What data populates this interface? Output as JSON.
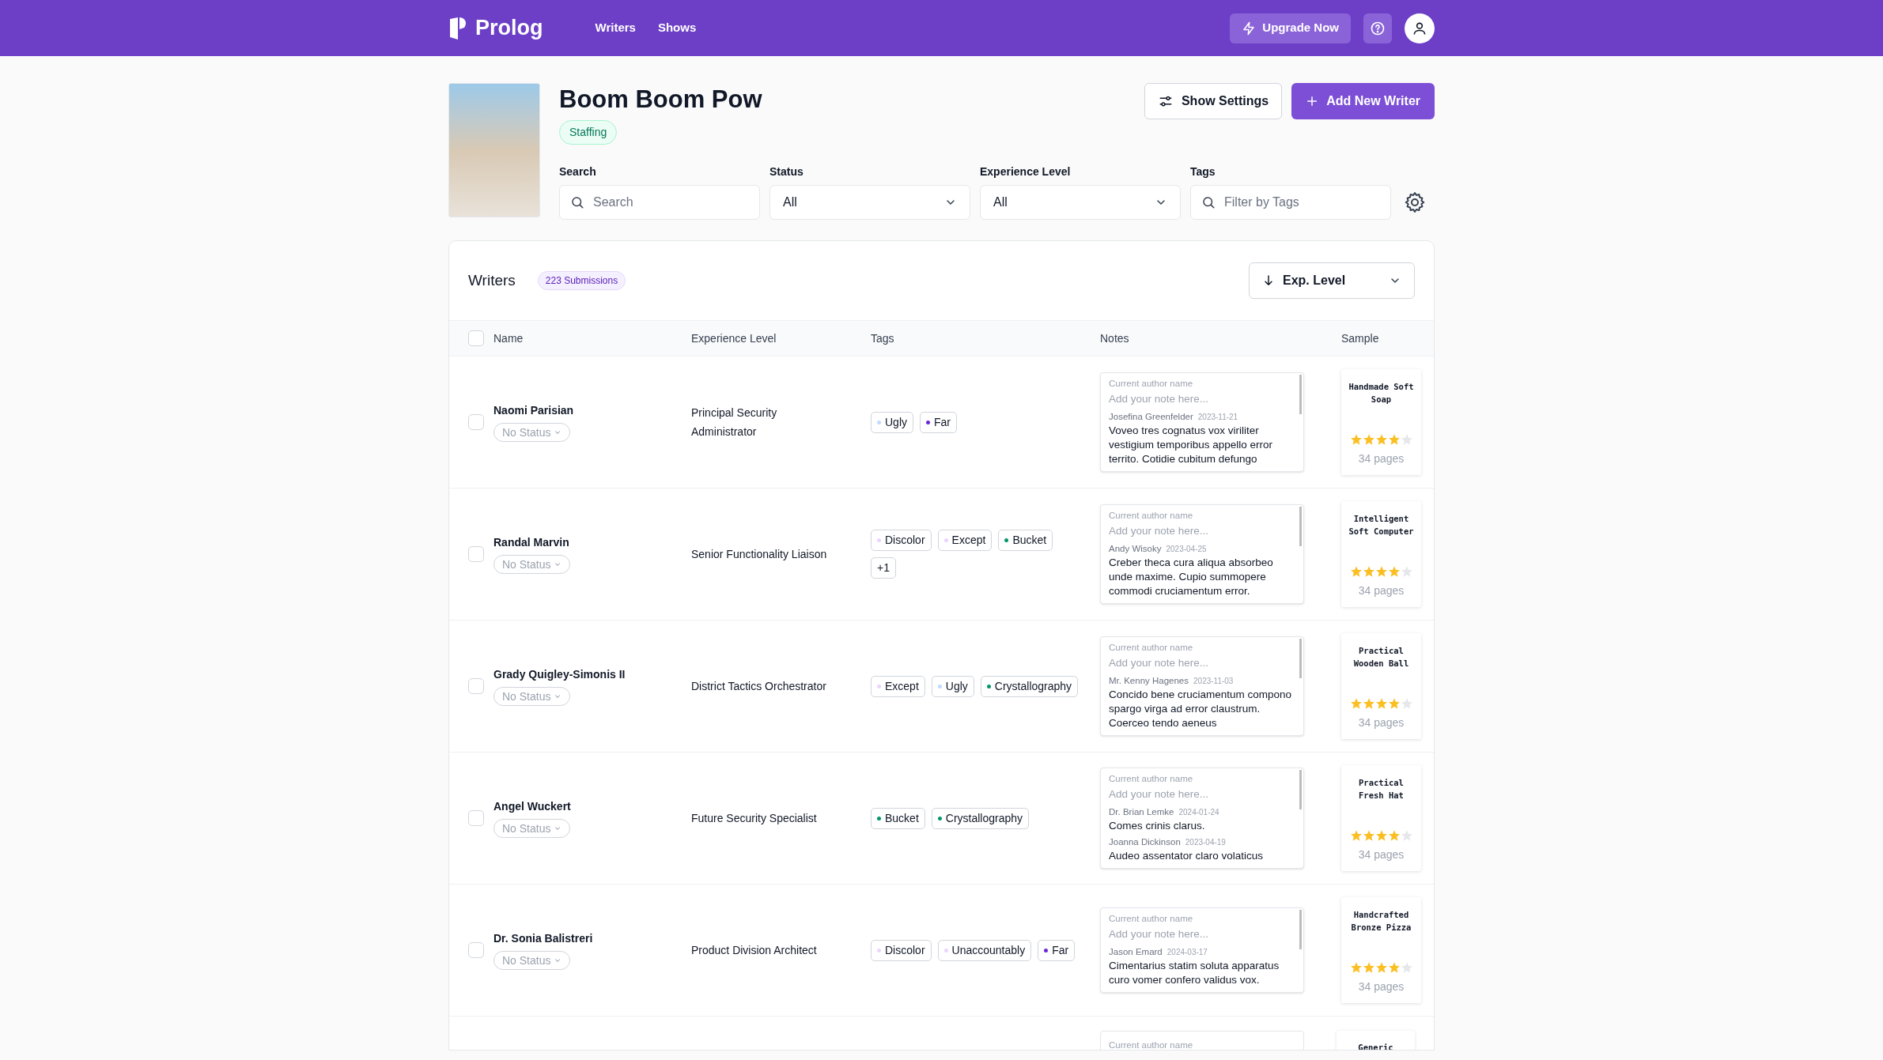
{
  "nav": {
    "logo": "Prolog",
    "links": [
      {
        "label": "Writers"
      },
      {
        "label": "Shows"
      }
    ],
    "upgrade": "Upgrade Now"
  },
  "show": {
    "title": "Boom Boom Pow",
    "badge": "Staffing",
    "actions": [
      {
        "kind": "secondary",
        "label": "Show Settings"
      },
      {
        "kind": "primary",
        "label": "Add New Writer"
      }
    ]
  },
  "filters": [
    {
      "kind": "search",
      "label": "Search",
      "placeholder": "Search"
    },
    {
      "kind": "select",
      "label": "Status",
      "value": "All"
    },
    {
      "kind": "select",
      "label": "Experience Level",
      "value": "All"
    },
    {
      "kind": "search",
      "label": "Tags",
      "placeholder": "Filter by Tags"
    }
  ],
  "writers": {
    "title": "Writers",
    "count": "223 Submissions",
    "sort": "Exp. Level",
    "select_all_checked": false,
    "columns": [
      "Name",
      "Experience Level",
      "Tags",
      "Notes",
      "Sample"
    ],
    "rows": [
      {
        "name": "Naomi Parisian",
        "checked": false,
        "status": "No Status",
        "experience": "Principal Security Administrator",
        "tags": [
          {
            "label": "Ugly",
            "color": "#bfdbfe"
          },
          {
            "label": "Far",
            "color": "#6d28d9"
          }
        ],
        "notes": {
          "label": "Current author name",
          "placeholder": "Add your note here...",
          "entries": [
            {
              "author": "Josefina Greenfelder",
              "date": "2023-11-21",
              "text": "Voveo tres cognatus vox viriliter vestigium temporibus appello error territo. Cotidie cubitum defungo"
            }
          ]
        },
        "sample": {
          "title": "Handmade Soft Soap",
          "stars": 4,
          "pages": "34 pages"
        }
      },
      {
        "name": "Randal Marvin",
        "checked": false,
        "status": "No Status",
        "experience": "Senior Functionality Liaison",
        "tags": [
          {
            "label": "Discolor",
            "color": "#e9d5ff"
          },
          {
            "label": "Except",
            "color": "#e9d5ff"
          },
          {
            "label": "Bucket",
            "color": "#059669"
          },
          {
            "label": "+1"
          }
        ],
        "notes": {
          "label": "Current author name",
          "placeholder": "Add your note here...",
          "entries": [
            {
              "author": "Andy Wisoky",
              "date": "2023-04-25",
              "text": "Creber theca cura aliqua absorbeo unde maxime. Cupio summopere commodi cruciamentum error."
            }
          ]
        },
        "sample": {
          "title": "Intelligent Soft Computer",
          "stars": 4,
          "pages": "34 pages"
        }
      },
      {
        "name": "Grady Quigley-Simonis II",
        "checked": false,
        "status": "No Status",
        "experience": "District Tactics Orchestrator",
        "tags": [
          {
            "label": "Except",
            "color": "#e9d5ff"
          },
          {
            "label": "Ugly",
            "color": "#bfdbfe"
          },
          {
            "label": "Crystallography",
            "color": "#059669"
          }
        ],
        "notes": {
          "label": "Current author name",
          "placeholder": "Add your note here...",
          "entries": [
            {
              "author": "Mr. Kenny Hagenes",
              "date": "2023-11-03",
              "text": "Concido bene cruciamentum compono spargo virga ad error claustrum. Coerceo tendo aeneus"
            }
          ]
        },
        "sample": {
          "title": "Practical Wooden Ball",
          "stars": 4,
          "pages": "34 pages"
        }
      },
      {
        "name": "Angel Wuckert",
        "checked": false,
        "status": "No Status",
        "experience": "Future Security Specialist",
        "tags": [
          {
            "label": "Bucket",
            "color": "#059669"
          },
          {
            "label": "Crystallography",
            "color": "#059669"
          }
        ],
        "notes": {
          "label": "Current author name",
          "placeholder": "Add your note here...",
          "entries": [
            {
              "author": "Dr. Brian Lemke",
              "date": "2024-01-24",
              "text": "Comes crinis clarus."
            },
            {
              "author": "Joanna Dickinson",
              "date": "2023-04-19",
              "text": "Audeo assentator claro volaticus"
            }
          ]
        },
        "sample": {
          "title": "Practical Fresh Hat",
          "stars": 4,
          "pages": "34 pages"
        }
      },
      {
        "name": "Dr. Sonia Balistreri",
        "checked": false,
        "status": "No Status",
        "experience": "Product Division Architect",
        "tags": [
          {
            "label": "Discolor",
            "color": "#e9d5ff"
          },
          {
            "label": "Unaccountably",
            "color": "#e9d5ff"
          },
          {
            "label": "Far",
            "color": "#6d28d9"
          }
        ],
        "notes": {
          "label": "Current author name",
          "placeholder": "Add your note here...",
          "entries": [
            {
              "author": "Jason Emard",
              "date": "2024-03-17",
              "text": "Cimentarius statim soluta apparatus curo vomer confero validus vox."
            }
          ]
        },
        "sample": {
          "title": "Handcrafted Bronze Pizza",
          "stars": 4,
          "pages": "34 pages"
        }
      }
    ],
    "partial_row": {
      "notes_label": "Current author name",
      "sample_title": "Generic"
    }
  }
}
